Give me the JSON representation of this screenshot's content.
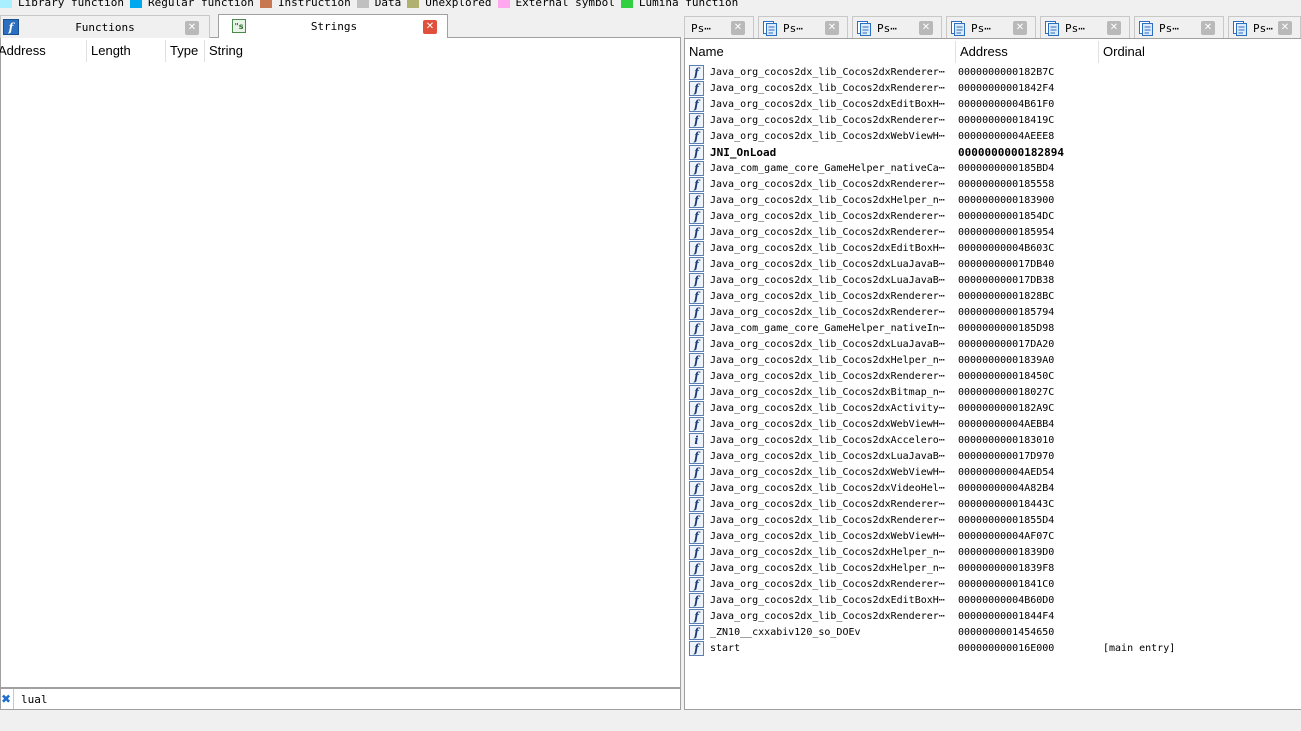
{
  "legend": [
    {
      "label": "Library function",
      "color": "#a8f0ff"
    },
    {
      "label": "Regular function",
      "color": "#00a8f0"
    },
    {
      "label": "Instruction",
      "color": "#c87850"
    },
    {
      "label": "Data",
      "color": "#c0c0c0"
    },
    {
      "label": "Unexplored",
      "color": "#b0b070"
    },
    {
      "label": "External symbol",
      "color": "#ffa8f0"
    },
    {
      "label": "Lumina function",
      "color": "#30d040"
    }
  ],
  "left_tabs": {
    "functions": {
      "label": "Functions",
      "icon": "function-icon"
    },
    "strings": {
      "label": "Strings",
      "icon": "strings-icon"
    }
  },
  "strings_table": {
    "columns": [
      "Address",
      "Length",
      "Type",
      "String"
    ]
  },
  "filter": {
    "value": "lual"
  },
  "right_tabs": [
    {
      "label": "Ps⋯",
      "icon": null
    },
    {
      "label": "Ps⋯",
      "icon": "pseudocode-icon"
    },
    {
      "label": "Ps⋯",
      "icon": "pseudocode-icon"
    },
    {
      "label": "Ps⋯",
      "icon": "pseudocode-icon"
    },
    {
      "label": "Ps⋯",
      "icon": "pseudocode-icon"
    },
    {
      "label": "Ps⋯",
      "icon": "pseudocode-icon"
    },
    {
      "label": "Ps⋯",
      "icon": "pseudocode-icon"
    }
  ],
  "exports_table": {
    "columns": [
      "Name",
      "Address",
      "Ordinal"
    ],
    "rows": [
      {
        "icon": "f",
        "name": "Java_org_cocos2dx_lib_Cocos2dxRenderer⋯",
        "address": "0000000000182B7C",
        "ordinal": ""
      },
      {
        "icon": "f",
        "name": "Java_org_cocos2dx_lib_Cocos2dxRenderer⋯",
        "address": "00000000001842F4",
        "ordinal": ""
      },
      {
        "icon": "f",
        "name": "Java_org_cocos2dx_lib_Cocos2dxEditBoxH⋯",
        "address": "00000000004B61F0",
        "ordinal": ""
      },
      {
        "icon": "f",
        "name": "Java_org_cocos2dx_lib_Cocos2dxRenderer⋯",
        "address": "000000000018419C",
        "ordinal": ""
      },
      {
        "icon": "f",
        "name": "Java_org_cocos2dx_lib_Cocos2dxWebViewH⋯",
        "address": "00000000004AEEE8",
        "ordinal": ""
      },
      {
        "icon": "f",
        "name": "JNI_OnLoad",
        "address": "0000000000182894",
        "ordinal": "",
        "bold": true
      },
      {
        "icon": "f",
        "name": "Java_com_game_core_GameHelper_nativeCa⋯",
        "address": "0000000000185BD4",
        "ordinal": ""
      },
      {
        "icon": "f",
        "name": "Java_org_cocos2dx_lib_Cocos2dxRenderer⋯",
        "address": "0000000000185558",
        "ordinal": ""
      },
      {
        "icon": "f",
        "name": "Java_org_cocos2dx_lib_Cocos2dxHelper_n⋯",
        "address": "0000000000183900",
        "ordinal": ""
      },
      {
        "icon": "f",
        "name": "Java_org_cocos2dx_lib_Cocos2dxRenderer⋯",
        "address": "00000000001854DC",
        "ordinal": ""
      },
      {
        "icon": "f",
        "name": "Java_org_cocos2dx_lib_Cocos2dxRenderer⋯",
        "address": "0000000000185954",
        "ordinal": ""
      },
      {
        "icon": "f",
        "name": "Java_org_cocos2dx_lib_Cocos2dxEditBoxH⋯",
        "address": "00000000004B603C",
        "ordinal": ""
      },
      {
        "icon": "f",
        "name": "Java_org_cocos2dx_lib_Cocos2dxLuaJavaB⋯",
        "address": "000000000017DB40",
        "ordinal": ""
      },
      {
        "icon": "f",
        "name": "Java_org_cocos2dx_lib_Cocos2dxLuaJavaB⋯",
        "address": "000000000017DB38",
        "ordinal": ""
      },
      {
        "icon": "f",
        "name": "Java_org_cocos2dx_lib_Cocos2dxRenderer⋯",
        "address": "00000000001828BC",
        "ordinal": ""
      },
      {
        "icon": "f",
        "name": "Java_org_cocos2dx_lib_Cocos2dxRenderer⋯",
        "address": "0000000000185794",
        "ordinal": ""
      },
      {
        "icon": "f",
        "name": "Java_com_game_core_GameHelper_nativeIn⋯",
        "address": "0000000000185D98",
        "ordinal": ""
      },
      {
        "icon": "f",
        "name": "Java_org_cocos2dx_lib_Cocos2dxLuaJavaB⋯",
        "address": "000000000017DA20",
        "ordinal": ""
      },
      {
        "icon": "f",
        "name": "Java_org_cocos2dx_lib_Cocos2dxHelper_n⋯",
        "address": "00000000001839A0",
        "ordinal": ""
      },
      {
        "icon": "f",
        "name": "Java_org_cocos2dx_lib_Cocos2dxRenderer⋯",
        "address": "000000000018450C",
        "ordinal": ""
      },
      {
        "icon": "f",
        "name": "Java_org_cocos2dx_lib_Cocos2dxBitmap_n⋯",
        "address": "000000000018027C",
        "ordinal": ""
      },
      {
        "icon": "f",
        "name": "Java_org_cocos2dx_lib_Cocos2dxActivity⋯",
        "address": "0000000000182A9C",
        "ordinal": ""
      },
      {
        "icon": "f",
        "name": "Java_org_cocos2dx_lib_Cocos2dxWebViewH⋯",
        "address": "00000000004AEBB4",
        "ordinal": ""
      },
      {
        "icon": "i",
        "name": "Java_org_cocos2dx_lib_Cocos2dxAccelero⋯",
        "address": "0000000000183010",
        "ordinal": ""
      },
      {
        "icon": "f",
        "name": "Java_org_cocos2dx_lib_Cocos2dxLuaJavaB⋯",
        "address": "000000000017D970",
        "ordinal": ""
      },
      {
        "icon": "f",
        "name": "Java_org_cocos2dx_lib_Cocos2dxWebViewH⋯",
        "address": "00000000004AED54",
        "ordinal": ""
      },
      {
        "icon": "f",
        "name": "Java_org_cocos2dx_lib_Cocos2dxVideoHel⋯",
        "address": "00000000004A82B4",
        "ordinal": ""
      },
      {
        "icon": "f",
        "name": "Java_org_cocos2dx_lib_Cocos2dxRenderer⋯",
        "address": "000000000018443C",
        "ordinal": ""
      },
      {
        "icon": "f",
        "name": "Java_org_cocos2dx_lib_Cocos2dxRenderer⋯",
        "address": "00000000001855D4",
        "ordinal": ""
      },
      {
        "icon": "f",
        "name": "Java_org_cocos2dx_lib_Cocos2dxWebViewH⋯",
        "address": "00000000004AF07C",
        "ordinal": ""
      },
      {
        "icon": "f",
        "name": "Java_org_cocos2dx_lib_Cocos2dxHelper_n⋯",
        "address": "00000000001839D0",
        "ordinal": ""
      },
      {
        "icon": "f",
        "name": "Java_org_cocos2dx_lib_Cocos2dxHelper_n⋯",
        "address": "00000000001839F8",
        "ordinal": ""
      },
      {
        "icon": "f",
        "name": "Java_org_cocos2dx_lib_Cocos2dxRenderer⋯",
        "address": "00000000001841C0",
        "ordinal": ""
      },
      {
        "icon": "f",
        "name": "Java_org_cocos2dx_lib_Cocos2dxEditBoxH⋯",
        "address": "00000000004B60D0",
        "ordinal": ""
      },
      {
        "icon": "f",
        "name": "Java_org_cocos2dx_lib_Cocos2dxRenderer⋯",
        "address": "00000000001844F4",
        "ordinal": ""
      },
      {
        "icon": "f",
        "name": "_ZN10__cxxabiv120_so_DOEv",
        "address": "0000000001454650",
        "ordinal": ""
      },
      {
        "icon": "f",
        "name": "start",
        "address": "000000000016E000",
        "ordinal": "[main entry]"
      }
    ]
  }
}
